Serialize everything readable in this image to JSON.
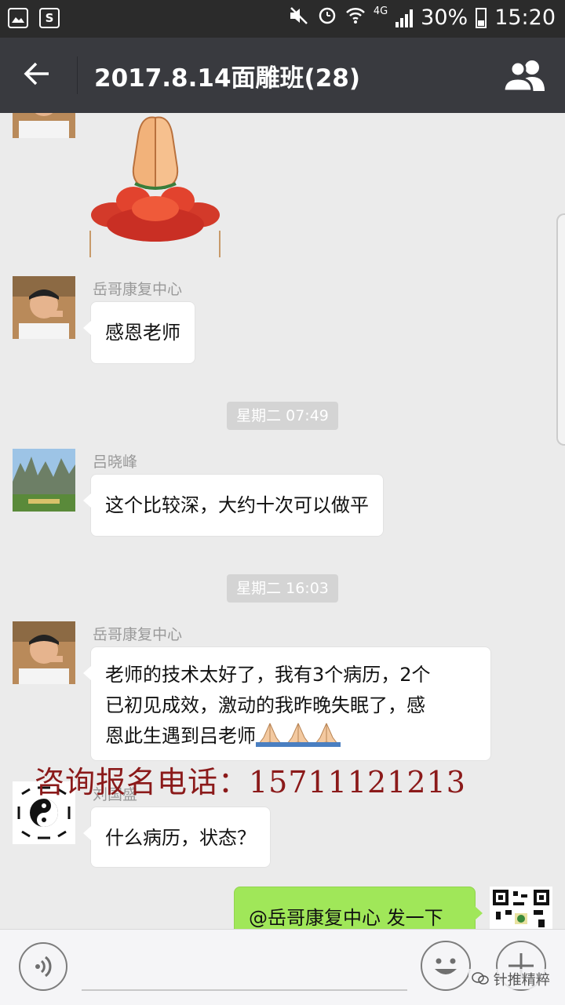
{
  "status_bar": {
    "battery": "30%",
    "time": "15:20",
    "network": "4G",
    "icons": [
      "image-icon",
      "s-app-icon",
      "mute-icon",
      "alarm-icon",
      "wifi-icon",
      "signal-icon",
      "battery-icon"
    ]
  },
  "header": {
    "back_icon": "back-arrow-icon",
    "title": "2017.8.14面雕班(28)",
    "members_icon": "group-members-icon"
  },
  "colors": {
    "header_bg": "#393a3f",
    "status_bg": "#2b2b2b",
    "chat_bg": "#ebebeb",
    "my_bubble": "#a0e759",
    "timestamp_bg": "#d4d4d4",
    "watermark_text": "#8b1a1a"
  },
  "messages": [
    {
      "type": "image",
      "content": "praying-hands-lotus-image"
    },
    {
      "sender": "岳哥康复中心",
      "text": "感恩老师"
    },
    {
      "type": "timestamp",
      "text": "星期二 07:49"
    },
    {
      "sender": "吕晓峰",
      "text": "这个比较深，大约十次可以做平"
    },
    {
      "type": "timestamp",
      "text": "星期二 16:03"
    },
    {
      "sender": "岳哥康复中心",
      "text_lines": [
        "老师的技术太好了，我有3个病历，2个",
        "已初见成效，激动的我昨晚失眠了，感",
        "恩此生遇到吕老师"
      ],
      "emoji": "🙏🙏🙏"
    },
    {
      "sender": "刘国盛",
      "text": "什么病历，状态？"
    },
    {
      "sender": "me",
      "text": "@岳哥康复中心 发一下"
    }
  ],
  "overlay": {
    "consult_phone": "咨询报名电话：15711121213"
  },
  "input_bar": {
    "voice_icon": "voice-icon",
    "emoji_icon": "emoji-icon",
    "plus_icon": "plus-icon",
    "brand": "针推精粹"
  }
}
